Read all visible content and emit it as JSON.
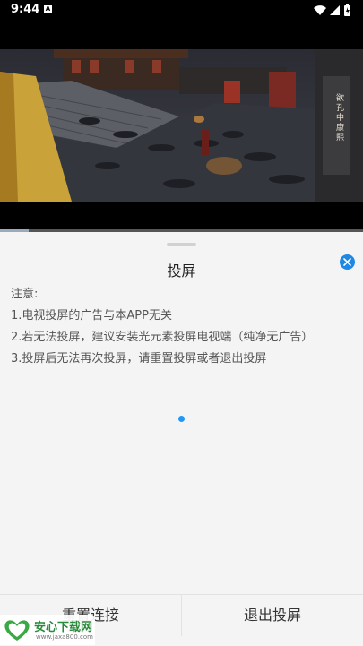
{
  "status_bar": {
    "time": "9:44",
    "notification_icon": "A",
    "icons": [
      "wifi-icon",
      "signal-icon",
      "battery-charging-icon"
    ]
  },
  "video": {
    "caption": "欲孔中 康熙",
    "progress": 0.08
  },
  "sheet": {
    "title": "投屏",
    "notice": [
      "注意:",
      "1.电视投屏的广告与本APP无关",
      "2.若无法投屏，建议安装光元素投屏电视端（纯净无广告）",
      "3.投屏后无法再次投屏，请重置投屏或者退出投屏"
    ],
    "buttons": {
      "reset": "重置连接",
      "exit": "退出投屏"
    }
  },
  "watermark": {
    "title": "安心下载网",
    "url": "www.jaxa800.com"
  },
  "colors": {
    "accent": "#2196f3",
    "sheet_bg": "#f4f4f4"
  }
}
